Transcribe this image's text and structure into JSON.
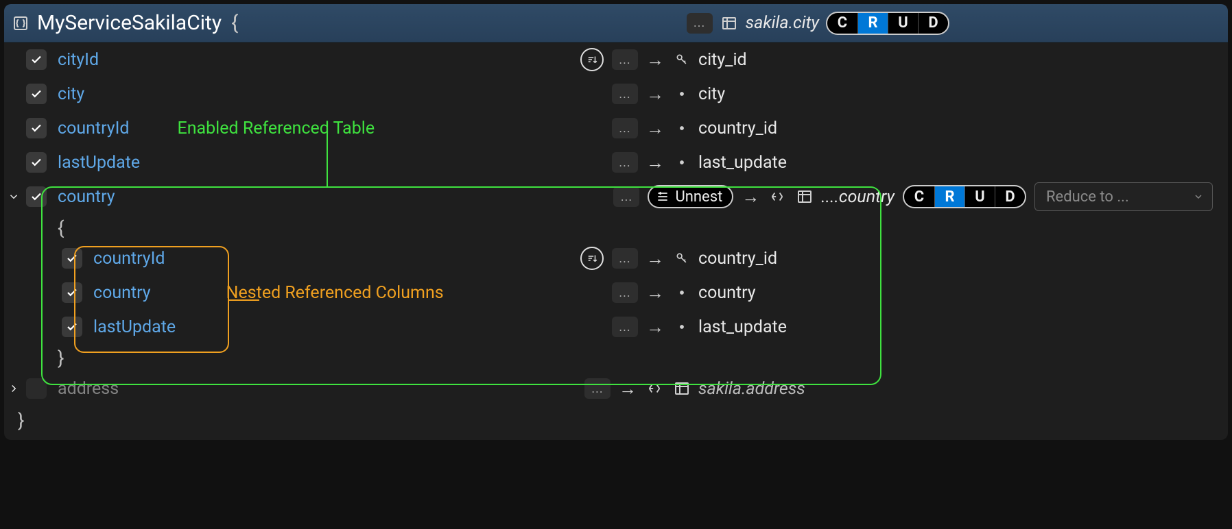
{
  "header": {
    "title": "MyServiceSakilaCity",
    "brace": "{",
    "ellipsis": "...",
    "table": "sakila.city",
    "crud": {
      "c": "C",
      "r": "R",
      "u": "U",
      "d": "D",
      "active": "R"
    }
  },
  "annotations": {
    "enabled_ref_table": "Enabled Referenced Table",
    "nested_ref_cols": "Nested Referenced Columns"
  },
  "fields": [
    {
      "name": "cityId",
      "checked": true,
      "sortable": true,
      "db": "city_id",
      "key": true
    },
    {
      "name": "city",
      "checked": true,
      "sortable": false,
      "db": "city",
      "key": false
    },
    {
      "name": "countryId",
      "checked": true,
      "sortable": false,
      "db": "country_id",
      "key": false
    },
    {
      "name": "lastUpdate",
      "checked": true,
      "sortable": false,
      "db": "last_update",
      "key": false
    }
  ],
  "country_ref": {
    "name": "country",
    "checked": true,
    "expanded": true,
    "ellipsis": "...",
    "unnest_label": "Unnest",
    "table": "....country",
    "crud": {
      "c": "C",
      "r": "R",
      "u": "U",
      "d": "D",
      "active": "R"
    },
    "reduce_placeholder": "Reduce to ...",
    "open_brace": "{",
    "close_brace": "}",
    "fields": [
      {
        "name": "countryId",
        "checked": true,
        "sortable": true,
        "db": "country_id",
        "key": true
      },
      {
        "name": "country",
        "checked": true,
        "sortable": false,
        "db": "country",
        "key": false
      },
      {
        "name": "lastUpdate",
        "checked": true,
        "sortable": false,
        "db": "last_update",
        "key": false
      }
    ]
  },
  "address_ref": {
    "name": "address",
    "checked": false,
    "expanded": false,
    "ellipsis": "...",
    "table": "sakila.address"
  },
  "close_brace": "}",
  "arrow": "→",
  "ellipsis": "..."
}
